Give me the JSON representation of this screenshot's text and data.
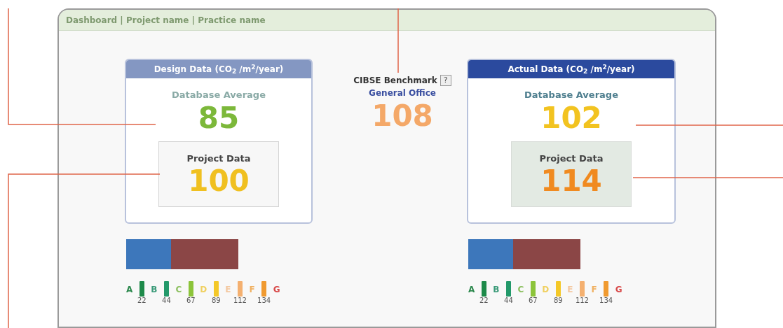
{
  "breadcrumb": "Dashboard | Project name | Practice name",
  "panels": [
    {
      "kind": "design",
      "title": "Design Data (CO$_{2}$ /m$^{2}$/year)",
      "average_label": "Database Average",
      "average": {
        "value": "85",
        "color": "#7cb83a"
      },
      "project_label": "Project Data",
      "project": {
        "value": "100",
        "color": "#f0c020"
      },
      "bar": {
        "level": 0.4
      },
      "grades": [
        {
          "letter": "A",
          "color": "#2f8a50"
        },
        {
          "letter": "B",
          "color": "#3a9a78"
        },
        {
          "letter": "C",
          "color": "#8cc060"
        },
        {
          "letter": "D",
          "color": "#f0d060"
        },
        {
          "letter": "E",
          "color": "#f4c8a0"
        },
        {
          "letter": "F",
          "color": "#f0b060"
        },
        {
          "letter": "G",
          "color": "#d84848"
        }
      ],
      "thresholds": [
        {
          "value": "22",
          "color": "#1e8a4a"
        },
        {
          "value": "44",
          "color": "#23996a"
        },
        {
          "value": "67",
          "color": "#8cc43a"
        },
        {
          "value": "89",
          "color": "#f4c828"
        },
        {
          "value": "112",
          "color": "#f4b070"
        },
        {
          "value": "134",
          "color": "#f09a30"
        }
      ]
    },
    {
      "kind": "actual",
      "title": "Actual Data (CO$_{2}$ /m$^{2}$/year)",
      "average_label": "Database Average",
      "average": {
        "value": "102",
        "color": "#f2c320"
      },
      "project_label": "Project Data",
      "project": {
        "value": "114",
        "color": "#f08a20"
      },
      "bar": {
        "level": 0.4
      },
      "grades": [
        {
          "letter": "A",
          "color": "#2f8a50"
        },
        {
          "letter": "B",
          "color": "#3a9a78"
        },
        {
          "letter": "C",
          "color": "#8cc060"
        },
        {
          "letter": "D",
          "color": "#f0d060"
        },
        {
          "letter": "E",
          "color": "#f4c8a0"
        },
        {
          "letter": "F",
          "color": "#f0b060"
        },
        {
          "letter": "G",
          "color": "#d84848"
        }
      ],
      "thresholds": [
        {
          "value": "22",
          "color": "#1e8a4a"
        },
        {
          "value": "44",
          "color": "#23996a"
        },
        {
          "value": "67",
          "color": "#8cc43a"
        },
        {
          "value": "89",
          "color": "#f4c828"
        },
        {
          "value": "112",
          "color": "#f4b070"
        },
        {
          "value": "134",
          "color": "#f09a30"
        }
      ]
    }
  ],
  "benchmark": {
    "title": "CIBSE Benchmark",
    "help": "?",
    "category": "General Office",
    "value": "108",
    "color": "#f4a868"
  }
}
